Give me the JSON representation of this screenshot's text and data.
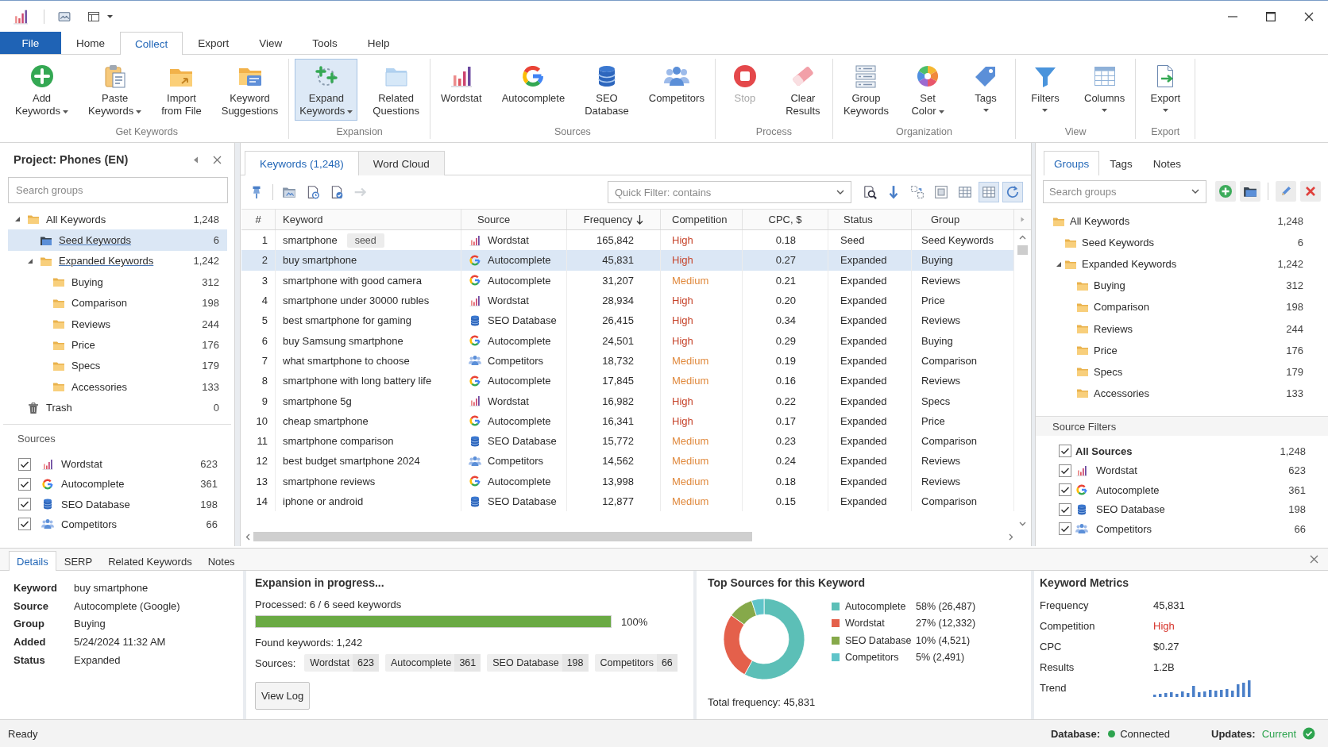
{
  "ribbon": {
    "tabs": [
      {
        "label": "File",
        "kind": "file",
        "selected": false
      },
      {
        "label": "Home",
        "kind": "tab",
        "selected": false
      },
      {
        "label": "Collect",
        "kind": "tab",
        "selected": true
      },
      {
        "label": "Export",
        "kind": "tab",
        "selected": false
      },
      {
        "label": "View",
        "kind": "tab",
        "selected": false
      },
      {
        "label": "Tools",
        "kind": "tab",
        "selected": false
      },
      {
        "label": "Help",
        "kind": "tab",
        "selected": false
      }
    ],
    "groups": [
      {
        "label": "Get Keywords",
        "buttons": [
          {
            "kind": "add",
            "label": "Add\nKeywords",
            "dropdown": true,
            "active": false,
            "disabled": false
          },
          {
            "kind": "paste",
            "label": "Paste\nKeywords",
            "dropdown": true,
            "active": false,
            "disabled": false
          },
          {
            "kind": "import",
            "label": "Import\nfrom File",
            "dropdown": false,
            "active": false,
            "disabled": false
          },
          {
            "kind": "suggestions",
            "label": "Keyword\nSuggestions",
            "dropdown": false,
            "active": false,
            "disabled": false
          }
        ]
      },
      {
        "label": "Expansion",
        "buttons": [
          {
            "kind": "expand",
            "label": "Expand\nKeywords",
            "dropdown": true,
            "active": true,
            "disabled": false
          },
          {
            "kind": "questions",
            "label": "Related\nQuestions",
            "dropdown": false,
            "active": false,
            "disabled": false
          }
        ]
      },
      {
        "label": "Sources",
        "buttons": [
          {
            "kind": "wordstat",
            "label": "Wordstat",
            "dropdown": false,
            "active": false,
            "disabled": false
          },
          {
            "kind": "autocomplete",
            "label": "Autocomplete",
            "dropdown": false,
            "active": false,
            "disabled": false
          },
          {
            "kind": "database",
            "label": "SEO\nDatabase",
            "dropdown": false,
            "active": false,
            "disabled": false
          },
          {
            "kind": "competitors",
            "label": "Competitors",
            "dropdown": false,
            "active": false,
            "disabled": false
          }
        ]
      },
      {
        "label": "Process",
        "buttons": [
          {
            "kind": "stop",
            "label": "Stop",
            "dropdown": false,
            "active": false,
            "disabled": true
          },
          {
            "kind": "clear",
            "label": "Clear\nResults",
            "dropdown": false,
            "active": false,
            "disabled": false
          }
        ]
      },
      {
        "label": "Organization",
        "buttons": [
          {
            "kind": "group",
            "label": "Group\nKeywords",
            "dropdown": false,
            "active": false,
            "disabled": false
          },
          {
            "kind": "color",
            "label": "Set\nColor",
            "dropdown": true,
            "active": false,
            "disabled": false
          },
          {
            "kind": "tags",
            "label": "Tags",
            "dropdown": true,
            "active": false,
            "disabled": false
          }
        ]
      },
      {
        "label": "View",
        "buttons": [
          {
            "kind": "filters",
            "label": "Filters",
            "dropdown": true,
            "active": false,
            "disabled": false
          },
          {
            "kind": "columns",
            "label": "Columns",
            "dropdown": true,
            "active": false,
            "disabled": false
          }
        ]
      },
      {
        "label": "Export",
        "buttons": [
          {
            "kind": "export",
            "label": "Export",
            "dropdown": true,
            "active": false,
            "disabled": false
          }
        ]
      }
    ]
  },
  "left_panel": {
    "title": "Project: Phones (EN)",
    "search": {
      "placeholder": "Search groups"
    },
    "tree": [
      {
        "kind": "folder",
        "label": "All Keywords",
        "count": "1,248",
        "expanded": true,
        "selected": false,
        "underlined": false,
        "children": [
          {
            "kind": "seed_folder",
            "label": "Seed Keywords",
            "count": "6",
            "selected": true,
            "underlined": true
          },
          {
            "kind": "folder",
            "label": "Expanded Keywords",
            "count": "1,242",
            "expanded": true,
            "selected": false,
            "underlined": true,
            "children": [
              {
                "kind": "folder",
                "label": "Buying",
                "count": "312",
                "selected": false,
                "underlined": false
              },
              {
                "kind": "folder",
                "label": "Comparison",
                "count": "198",
                "selected": false,
                "underlined": false
              },
              {
                "kind": "folder",
                "label": "Reviews",
                "count": "244",
                "selected": false,
                "underlined": false
              },
              {
                "kind": "folder",
                "label": "Price",
                "count": "176",
                "selected": false,
                "underlined": false
              },
              {
                "kind": "folder",
                "label": "Specs",
                "count": "179",
                "selected": false,
                "underlined": false
              },
              {
                "kind": "folder",
                "label": "Accessories",
                "count": "133",
                "selected": false,
                "underlined": false
              }
            ]
          }
        ]
      },
      {
        "kind": "trash",
        "label": "Trash",
        "count": "0",
        "selected": false,
        "underlined": false
      }
    ],
    "sources_title": "Sources",
    "sources": [
      {
        "kind": "wordstat",
        "label": "Wordstat",
        "count": "623",
        "checked": true
      },
      {
        "kind": "autocomplete",
        "label": "Autocomplete",
        "count": "361",
        "checked": true
      },
      {
        "kind": "database",
        "label": "SEO Database",
        "count": "198",
        "checked": true
      },
      {
        "kind": "competitors",
        "label": "Competitors",
        "count": "66",
        "checked": true
      }
    ]
  },
  "center": {
    "tabs": [
      {
        "label": "Keywords (1,248)",
        "selected": true
      },
      {
        "label": "Word Cloud",
        "selected": false
      }
    ],
    "toolbar": {
      "left": [
        {
          "kind": "pin",
          "pressed": false,
          "disabled": false
        },
        {
          "kind": "folder",
          "pressed": false,
          "disabled": false
        },
        {
          "kind": "document",
          "pressed": false,
          "disabled": false
        },
        {
          "kind": "document_check",
          "pressed": false,
          "disabled": false
        },
        {
          "kind": "arrow_right",
          "pressed": false,
          "disabled": true
        }
      ],
      "right": [
        {
          "kind": "search",
          "pressed": false,
          "disabled": false
        },
        {
          "kind": "arrow_down",
          "pressed": false,
          "disabled": false
        },
        {
          "kind": "dashed_boxes",
          "pressed": false,
          "disabled": false
        },
        {
          "kind": "frame",
          "pressed": false,
          "disabled": false
        },
        {
          "kind": "table",
          "pressed": false,
          "disabled": false
        },
        {
          "kind": "table",
          "pressed": true,
          "disabled": false
        },
        {
          "kind": "refresh",
          "pressed": true,
          "disabled": false
        }
      ]
    },
    "quick_filter": {
      "placeholder": "Quick Filter: contains"
    },
    "table": {
      "columns": [
        {
          "label": "#",
          "sorted": false
        },
        {
          "label": "Keyword",
          "sorted": false
        },
        {
          "label": "Source",
          "sorted": false
        },
        {
          "label": "Frequency",
          "sorted": true
        },
        {
          "label": "Competition",
          "sorted": false
        },
        {
          "label": "CPC, $",
          "sorted": false
        },
        {
          "label": "Status",
          "sorted": false
        },
        {
          "label": "Group",
          "sorted": false
        }
      ],
      "rows": [
        {
          "index": "1",
          "keyword": "smartphone",
          "tag": "seed",
          "source": {
            "kind": "wordstat",
            "label": "Wordstat"
          },
          "frequency": "165,842",
          "competition": {
            "label": "High",
            "color": "#c6452c"
          },
          "cpc": "0.18",
          "status": "Seed",
          "group": "Seed Keywords",
          "selected": false
        },
        {
          "index": "2",
          "keyword": "buy smartphone",
          "source": {
            "kind": "autocomplete",
            "label": "Autocomplete"
          },
          "frequency": "45,831",
          "competition": {
            "label": "High",
            "color": "#c6452c"
          },
          "cpc": "0.27",
          "status": "Expanded",
          "group": "Buying",
          "selected": true
        },
        {
          "index": "3",
          "keyword": "smartphone with good camera",
          "source": {
            "kind": "autocomplete",
            "label": "Autocomplete"
          },
          "frequency": "31,207",
          "competition": {
            "label": "Medium",
            "color": "#e0893d"
          },
          "cpc": "0.21",
          "status": "Expanded",
          "group": "Reviews",
          "selected": false
        },
        {
          "index": "4",
          "keyword": "smartphone under 30000 rubles",
          "source": {
            "kind": "wordstat",
            "label": "Wordstat"
          },
          "frequency": "28,934",
          "competition": {
            "label": "High",
            "color": "#c6452c"
          },
          "cpc": "0.20",
          "status": "Expanded",
          "group": "Price",
          "selected": false
        },
        {
          "index": "5",
          "keyword": "best smartphone for gaming",
          "source": {
            "kind": "database",
            "label": "SEO Database"
          },
          "frequency": "26,415",
          "competition": {
            "label": "High",
            "color": "#c6452c"
          },
          "cpc": "0.34",
          "status": "Expanded",
          "group": "Reviews",
          "selected": false
        },
        {
          "index": "6",
          "keyword": "buy Samsung smartphone",
          "source": {
            "kind": "autocomplete",
            "label": "Autocomplete"
          },
          "frequency": "24,501",
          "competition": {
            "label": "High",
            "color": "#c6452c"
          },
          "cpc": "0.29",
          "status": "Expanded",
          "group": "Buying",
          "selected": false
        },
        {
          "index": "7",
          "keyword": "what smartphone to choose",
          "source": {
            "kind": "competitors",
            "label": "Competitors"
          },
          "frequency": "18,732",
          "competition": {
            "label": "Medium",
            "color": "#e0893d"
          },
          "cpc": "0.19",
          "status": "Expanded",
          "group": "Comparison",
          "selected": false
        },
        {
          "index": "8",
          "keyword": "smartphone with long battery life",
          "source": {
            "kind": "autocomplete",
            "label": "Autocomplete"
          },
          "frequency": "17,845",
          "competition": {
            "label": "Medium",
            "color": "#e0893d"
          },
          "cpc": "0.16",
          "status": "Expanded",
          "group": "Reviews",
          "selected": false
        },
        {
          "index": "9",
          "keyword": "smartphone 5g",
          "source": {
            "kind": "wordstat",
            "label": "Wordstat"
          },
          "frequency": "16,982",
          "competition": {
            "label": "High",
            "color": "#c6452c"
          },
          "cpc": "0.22",
          "status": "Expanded",
          "group": "Specs",
          "selected": false
        },
        {
          "index": "10",
          "keyword": "cheap smartphone",
          "source": {
            "kind": "autocomplete",
            "label": "Autocomplete"
          },
          "frequency": "16,341",
          "competition": {
            "label": "High",
            "color": "#c6452c"
          },
          "cpc": "0.17",
          "status": "Expanded",
          "group": "Price",
          "selected": false
        },
        {
          "index": "11",
          "keyword": "smartphone comparison",
          "source": {
            "kind": "database",
            "label": "SEO Database"
          },
          "frequency": "15,772",
          "competition": {
            "label": "Medium",
            "color": "#e0893d"
          },
          "cpc": "0.23",
          "status": "Expanded",
          "group": "Comparison",
          "selected": false
        },
        {
          "index": "12",
          "keyword": "best budget smartphone 2024",
          "source": {
            "kind": "competitors",
            "label": "Competitors"
          },
          "frequency": "14,562",
          "competition": {
            "label": "Medium",
            "color": "#e0893d"
          },
          "cpc": "0.24",
          "status": "Expanded",
          "group": "Reviews",
          "selected": false
        },
        {
          "index": "13",
          "keyword": "smartphone reviews",
          "source": {
            "kind": "autocomplete",
            "label": "Autocomplete"
          },
          "frequency": "13,998",
          "competition": {
            "label": "Medium",
            "color": "#e0893d"
          },
          "cpc": "0.18",
          "status": "Expanded",
          "group": "Reviews",
          "selected": false
        },
        {
          "index": "14",
          "keyword": "iphone or android",
          "source": {
            "kind": "database",
            "label": "SEO Database"
          },
          "frequency": "12,877",
          "competition": {
            "label": "Medium",
            "color": "#e0893d"
          },
          "cpc": "0.15",
          "status": "Expanded",
          "group": "Comparison",
          "selected": false
        }
      ]
    }
  },
  "right_panel": {
    "tabs": [
      {
        "label": "Groups",
        "selected": true
      },
      {
        "label": "Tags",
        "selected": false
      },
      {
        "label": "Notes",
        "selected": false
      }
    ],
    "search": {
      "placeholder": "Search groups"
    },
    "tree": [
      {
        "kind": "folder",
        "label": "All Keywords",
        "count": "1,248",
        "selected": false,
        "children": [
          {
            "kind": "folder",
            "label": "Seed Keywords",
            "count": "6",
            "selected": false
          },
          {
            "kind": "folder",
            "label": "Expanded Keywords",
            "count": "1,242",
            "expanded": true,
            "selected": false,
            "children": [
              {
                "kind": "folder",
                "label": "Buying",
                "count": "312",
                "selected": false
              },
              {
                "kind": "folder",
                "label": "Comparison",
                "count": "198",
                "selected": false
              },
              {
                "kind": "folder",
                "label": "Reviews",
                "count": "244",
                "selected": false
              },
              {
                "kind": "folder",
                "label": "Price",
                "count": "176",
                "selected": false
              },
              {
                "kind": "folder",
                "label": "Specs",
                "count": "179",
                "selected": false
              },
              {
                "kind": "folder",
                "label": "Accessories",
                "count": "133",
                "selected": false
              }
            ]
          }
        ]
      }
    ],
    "filters_title": "Source Filters",
    "filters": [
      {
        "kind": "all",
        "label": "All Sources",
        "count": "1,248",
        "checked": true
      },
      {
        "kind": "wordstat",
        "label": "Wordstat",
        "count": "623",
        "checked": true
      },
      {
        "kind": "autocomplete",
        "label": "Autocomplete",
        "count": "361",
        "checked": true
      },
      {
        "kind": "database",
        "label": "SEO Database",
        "count": "198",
        "checked": true
      },
      {
        "kind": "competitors",
        "label": "Competitors",
        "count": "66",
        "checked": true
      }
    ]
  },
  "bottom": {
    "tabs": [
      {
        "label": "Details",
        "selected": true
      },
      {
        "label": "SERP",
        "selected": false
      },
      {
        "label": "Related Keywords",
        "selected": false
      },
      {
        "label": "Notes",
        "selected": false
      }
    ],
    "details": [
      {
        "label": "Keyword",
        "value": "buy smartphone"
      },
      {
        "label": "Source",
        "value": "Autocomplete (Google)"
      },
      {
        "label": "Group",
        "value": "Buying"
      },
      {
        "label": "Added",
        "value": "5/24/2024 11:32 AM"
      },
      {
        "label": "Status",
        "value": "Expanded"
      }
    ],
    "expansion": {
      "title": "Expansion in progress...",
      "processed": "Processed: 6 / 6 seed keywords",
      "level": 1,
      "percent": "100%",
      "found": "Found keywords: 1,242",
      "sources_label": "Sources:",
      "chips": [
        {
          "label": "Wordstat",
          "count": "623"
        },
        {
          "label": "Autocomplete",
          "count": "361"
        },
        {
          "label": "SEO Database",
          "count": "198"
        },
        {
          "label": "Competitors",
          "count": "66"
        }
      ],
      "button": "View Log"
    },
    "top_sources": {
      "chart_data": {
        "type": "donut",
        "title": "Top Sources for this Keyword",
        "categories": [
          "Autocomplete",
          "Wordstat",
          "SEO Database",
          "Competitors"
        ],
        "values": [
          58,
          27,
          10,
          5
        ],
        "value_labels": [
          "58% (26,487)",
          "27% (12,332)",
          "10% (4,521)",
          "5% (2,491)"
        ]
      },
      "legend": [
        {
          "color": "#5cbfb7"
        },
        {
          "color": "#e4604b"
        },
        {
          "color": "#86a94a"
        },
        {
          "color": "#5fc4c9"
        }
      ],
      "total": "Total frequency: 45,831"
    },
    "metrics": {
      "title": "Keyword Metrics",
      "rows": [
        {
          "kind": "text",
          "label": "Frequency",
          "value": "45,831"
        },
        {
          "kind": "text",
          "label": "Competition",
          "value": "High",
          "color": "#d6332a"
        },
        {
          "kind": "text",
          "label": "CPC",
          "value": "$0.27"
        },
        {
          "kind": "text",
          "label": "Results",
          "value": "1.2B"
        },
        {
          "kind": "trend",
          "label": "Trend"
        }
      ]
    }
  },
  "status_bar": {
    "text": "Ready",
    "database": {
      "label": "Database:",
      "value": "Connected",
      "connected": true
    },
    "updates": {
      "label": "Updates:",
      "value": "Current",
      "up_to_date": true
    }
  }
}
